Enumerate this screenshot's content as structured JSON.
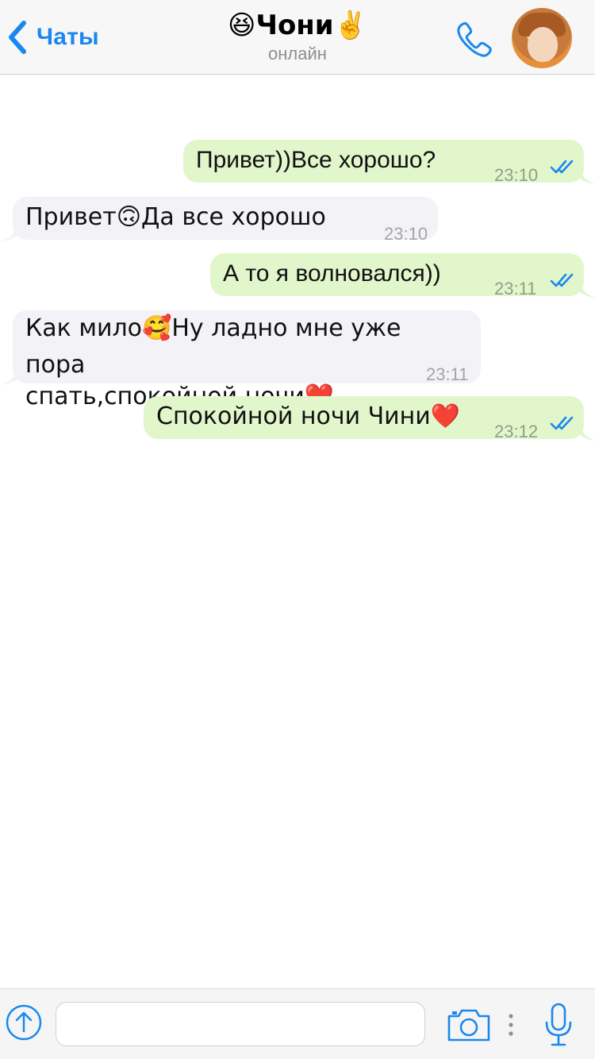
{
  "header": {
    "back_label": "Чаты",
    "title": "😆Чони✌️",
    "status": "онлайн",
    "accent": "#1a87f0"
  },
  "messages": [
    {
      "direction": "outgoing",
      "text": "Привет))Все хорошо?",
      "time": "23:10",
      "read": true
    },
    {
      "direction": "incoming",
      "text": "Привет🙃Да все хорошо",
      "time": "23:10"
    },
    {
      "direction": "outgoing",
      "text": "А то я волновался))",
      "time": "23:11",
      "read": true
    },
    {
      "direction": "incoming",
      "text": "Как мило🥰Ну ладно мне уже пора спать,спокойной ночи❤️",
      "line1": "Как мило🥰Ну ладно мне уже пора",
      "line2": "спать,спокойной ночи❤️",
      "time": "23:11"
    },
    {
      "direction": "outgoing",
      "text": "Спокойной ночи Чини❤️",
      "time": "23:12",
      "read": true
    }
  ],
  "colors": {
    "outgoing_bubble": "#e1f6cb",
    "incoming_bubble": "#f3f3f7",
    "read_checks": "#1a87f0"
  },
  "input": {
    "placeholder": "",
    "value": ""
  },
  "icons": [
    "chevron-left-icon",
    "phone-icon",
    "avatar",
    "attach-arrow-up-icon",
    "camera-icon",
    "more-dots-icon",
    "microphone-icon",
    "double-check-icon"
  ]
}
